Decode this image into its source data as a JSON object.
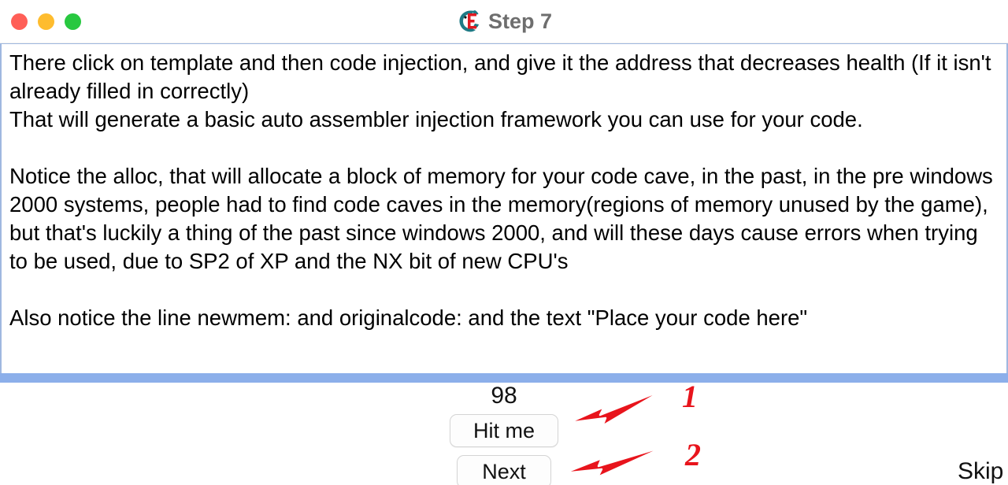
{
  "window": {
    "title": "Step 7",
    "app_icon": "cheat-engine-logo-icon",
    "controls": {
      "close": "close-window-button",
      "minimize": "minimize-window-button",
      "maximize": "maximize-window-button"
    },
    "colors": {
      "close": "#ff5f57",
      "minimize": "#febc2e",
      "maximize": "#28c840",
      "scrollbar": "#8cafea",
      "textarea_border": "#9fb8e0",
      "annotation_red": "#e8141c",
      "title_text": "#6e6e6e"
    }
  },
  "tutorial": {
    "body": "There click on template and then code injection, and give it the address that decreases health (If it isn't already filled in correctly)\nThat will generate a basic auto assembler injection framework you can use for your code.\n\nNotice the alloc, that will allocate a block of memory for your code cave, in the past, in the pre windows 2000 systems, people had to find code caves in the memory(regions of memory unused by the game), but that's luckily a thing of the past since windows 2000, and will these days cause errors when trying to be used, due to SP2 of XP and the NX bit of new CPU's\n\nAlso notice the line newmem: and originalcode: and the text \"Place your code here\""
  },
  "controls": {
    "health_value": "98",
    "hit_me_label": "Hit me",
    "next_label": "Next",
    "skip_label": "Skip"
  },
  "annotations": [
    {
      "number": "1",
      "target": "hit-me-button"
    },
    {
      "number": "2",
      "target": "next-button"
    }
  ]
}
